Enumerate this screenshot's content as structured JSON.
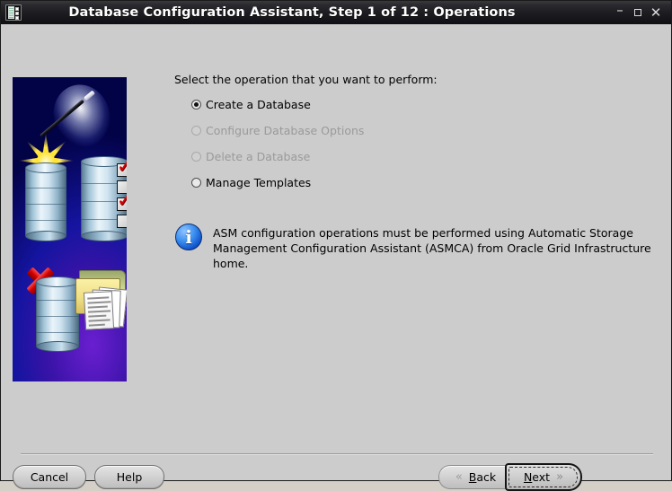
{
  "window": {
    "title": "Database Configuration Assistant, Step 1 of 12 : Operations",
    "app_icon": "database-app-icon",
    "controls": {
      "minimize": "–",
      "maximize": "maximize-icon",
      "close": "✕"
    }
  },
  "main": {
    "prompt": "Select the operation that you want to perform:",
    "options": [
      {
        "label": "Create a Database",
        "selected": true,
        "enabled": true
      },
      {
        "label": "Configure Database Options",
        "selected": false,
        "enabled": false
      },
      {
        "label": "Delete a Database",
        "selected": false,
        "enabled": false
      },
      {
        "label": "Manage Templates",
        "selected": false,
        "enabled": true
      }
    ],
    "note": {
      "icon": "info-icon",
      "line1": "ASM configuration operations must be performed using Automatic Storage",
      "line2": "Management Configuration Assistant (ASMCA) from Oracle Grid Infrastructure home."
    },
    "illustration": {
      "alt": "wizard-wand-and-databases-banner"
    }
  },
  "footer": {
    "cancel": "Cancel",
    "help": "Help",
    "back": "Back",
    "back_mnemonic": "B",
    "back_chevron": "«",
    "next": "Next",
    "next_mnemonic": "N",
    "next_chevron": "»"
  },
  "colors": {
    "titlebar": "#1b1b20",
    "window_bg": "#cccccc",
    "banner_blue": "#1010c8",
    "accent_red": "#d00000",
    "info_blue": "#3a8ef0",
    "disabled_text": "#9a9a9a"
  }
}
